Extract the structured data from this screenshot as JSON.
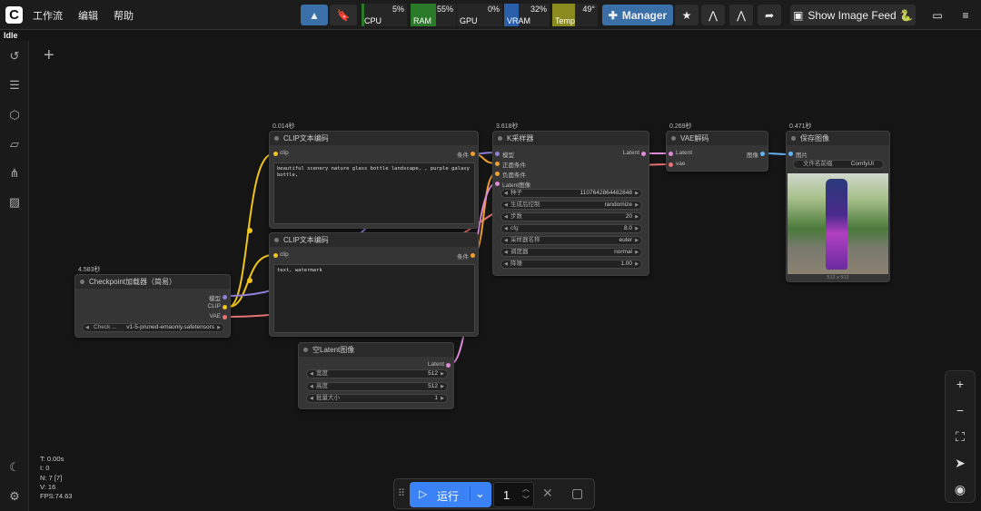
{
  "menu": [
    "工作流",
    "编辑",
    "帮助"
  ],
  "monitors": [
    {
      "label": "CPU",
      "value": "5%",
      "level": 0.05,
      "color": "#2a7a2a"
    },
    {
      "label": "RAM",
      "value": "55%",
      "level": 0.55,
      "color": "#2a7a2a"
    },
    {
      "label": "GPU",
      "value": "0%",
      "level": 0.0,
      "color": "#2a7a2a"
    },
    {
      "label": "VRAM",
      "value": "32%",
      "level": 0.32,
      "color": "#2a5ea8"
    },
    {
      "label": "Temp",
      "value": "49°",
      "level": 0.49,
      "color": "#8a8a1f"
    }
  ],
  "toolbar": {
    "manager_label": "Manager",
    "feed_label": "Show Image Feed 🐍"
  },
  "status": "Idle",
  "nodes": {
    "clip1": {
      "time": "0.014秒",
      "title": "CLIP文本编码",
      "in": "clip",
      "out": "条件",
      "text": "beautiful scenery nature glass bottle landscape, , purple galaxy bottle,"
    },
    "clip2": {
      "title": "CLIP文本编码",
      "in": "clip",
      "out": "条件",
      "text": "text, watermark"
    },
    "ckpt": {
      "time": "4.583秒",
      "title": "Checkpoint加载器（简易）",
      "out1": "模型",
      "out2": "CLIP",
      "out3": "VAE",
      "w_label": "Check ...",
      "w_value": "v1-5-pruned-emaonly.safetensors"
    },
    "ksampler": {
      "time": "3.618秒",
      "title": "K采样器",
      "in1": "模型",
      "in2": "正面条件",
      "in3": "负面条件",
      "in4": "Latent图像",
      "out": "Latent",
      "widgets": [
        {
          "label": "种子",
          "value": "1107642864482848"
        },
        {
          "label": "生成后控制",
          "value": "randomize"
        },
        {
          "label": "步数",
          "value": "20"
        },
        {
          "label": "cfg",
          "value": "8.0"
        },
        {
          "label": "采样器名称",
          "value": "euler"
        },
        {
          "label": "调度器",
          "value": "normal"
        },
        {
          "label": "降噪",
          "value": "1.00"
        }
      ]
    },
    "vae": {
      "time": "0.269秒",
      "title": "VAE解码",
      "in1": "Latent",
      "in2": "vae",
      "out": "图像"
    },
    "save": {
      "time": "0.471秒",
      "title": "保存图像",
      "in": "图片",
      "w_label": "文件名前缀",
      "w_value": "ComfyUI",
      "size": "512 x 512"
    },
    "latent": {
      "title": "空Latent图像",
      "out": "Latent",
      "widgets": [
        {
          "label": "宽度",
          "value": "512"
        },
        {
          "label": "高度",
          "value": "512"
        },
        {
          "label": "批量大小",
          "value": "1"
        }
      ]
    }
  },
  "stats": {
    "t": "T: 0.00s",
    "i": "I: 0",
    "n": "N: 7 [7]",
    "v": "V: 16",
    "fps": "FPS:74.63"
  },
  "runbar": {
    "run_label": "运行",
    "count": "1"
  }
}
